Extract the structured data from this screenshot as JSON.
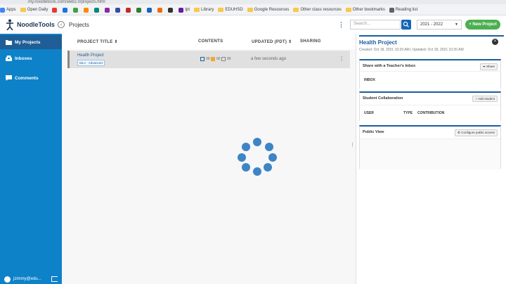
{
  "browser": {
    "url": "my.noodletools.com/web2.0/projects.html",
    "bookmarks": [
      {
        "label": "Apps",
        "color": "#4285f4"
      },
      {
        "label": "Open Daily",
        "color": "#f9c74f"
      },
      {
        "label": "",
        "color": "#e53935"
      },
      {
        "label": "",
        "color": "#1a73e8"
      },
      {
        "label": "",
        "color": "#43a047"
      },
      {
        "label": "",
        "color": "#fb8c00"
      },
      {
        "label": "",
        "color": "#00897b"
      },
      {
        "label": "",
        "color": "#8e24aa"
      },
      {
        "label": "",
        "color": "#3949ab"
      },
      {
        "label": "",
        "color": "#c62828"
      },
      {
        "label": "",
        "color": "#2e7d32"
      },
      {
        "label": "",
        "color": "#1565c0"
      },
      {
        "label": "",
        "color": "#ef6c00"
      },
      {
        "label": "",
        "color": "#333333"
      },
      {
        "label": "tpt",
        "color": "#6a1b9a"
      },
      {
        "label": "Library",
        "color": "#f9c74f"
      },
      {
        "label": "EDUHSD",
        "color": "#f9c74f"
      },
      {
        "label": "Google Resources",
        "color": "#f9c74f"
      },
      {
        "label": "Other class resources",
        "color": "#f9c74f"
      },
      {
        "label": "Other bookmarks",
        "color": "#f9c74f"
      },
      {
        "label": "Reading list",
        "color": "#5f6368"
      }
    ]
  },
  "sidebar": {
    "logo": "NoodleTools",
    "items": [
      {
        "label": "My Projects"
      },
      {
        "label": "Inboxes"
      },
      {
        "label": "Comments"
      }
    ],
    "user": "jzimmy@edu..."
  },
  "header": {
    "title": "Projects",
    "search_placeholder": "Search...",
    "year": "2021 - 2022",
    "new_project": "+ New Project"
  },
  "table": {
    "columns": [
      "PROJECT TITLE",
      "CONTENTS",
      "UPDATED (PDT)",
      "SHARING"
    ],
    "rows": [
      {
        "title": "Health Project",
        "tag": "MLA · Advanced",
        "sources": "00",
        "notecards": "00",
        "docs": "00",
        "updated": "a few seconds ago"
      }
    ]
  },
  "panel": {
    "title": "Health Project",
    "meta": "Created: Oct 18, 2021 10:20 AM | Updated: Oct 18, 2021 10:20 AM",
    "share_title": "Share with a Teacher's Inbox",
    "share_button": "Share",
    "inbox_header": "INBOX",
    "collab_title": "Student Collaboration",
    "add_student": "Add student",
    "collab_columns": [
      "USER",
      "TYPE",
      "CONTRIBUTION"
    ],
    "public_title": "Public View",
    "configure": "Configure public access"
  }
}
